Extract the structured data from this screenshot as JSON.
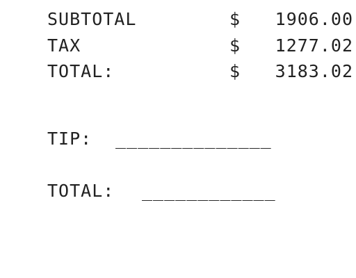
{
  "receipt": {
    "subtotal": {
      "label": "SUBTOTAL",
      "currency": "$",
      "amount": "1906.00"
    },
    "tax": {
      "label": "TAX",
      "currency": "$",
      "amount": "1277.02"
    },
    "total": {
      "label": "TOTAL:",
      "currency": "$",
      "amount": "3183.02"
    },
    "tip": {
      "label": "TIP:",
      "blank": "______________"
    },
    "grand_total": {
      "label": "TOTAL:",
      "blank": "____________"
    }
  }
}
